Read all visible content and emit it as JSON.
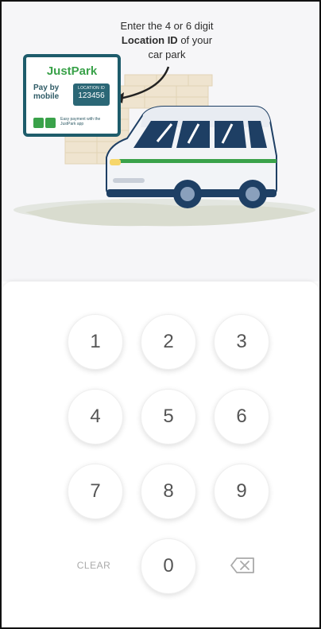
{
  "instruction": {
    "line1": "Enter the 4 or 6 digit",
    "line2_bold": "Location ID",
    "line2_rest": " of your",
    "line3": "car park"
  },
  "sign": {
    "brand": "JustPark",
    "pay_line1": "Pay by",
    "pay_line2": "mobile",
    "location_label": "LOCATION ID",
    "location_value": "123456",
    "footer": "Easy payment with the JustPark app"
  },
  "keypad": {
    "keys": {
      "k1": "1",
      "k2": "2",
      "k3": "3",
      "k4": "4",
      "k5": "5",
      "k6": "6",
      "k7": "7",
      "k8": "8",
      "k9": "9",
      "k0": "0"
    },
    "clear_label": "CLEAR",
    "backspace_icon": "backspace-icon"
  },
  "colors": {
    "brand_green": "#3aa24a",
    "sign_border": "#1e5c6b",
    "key_text": "#555555"
  }
}
